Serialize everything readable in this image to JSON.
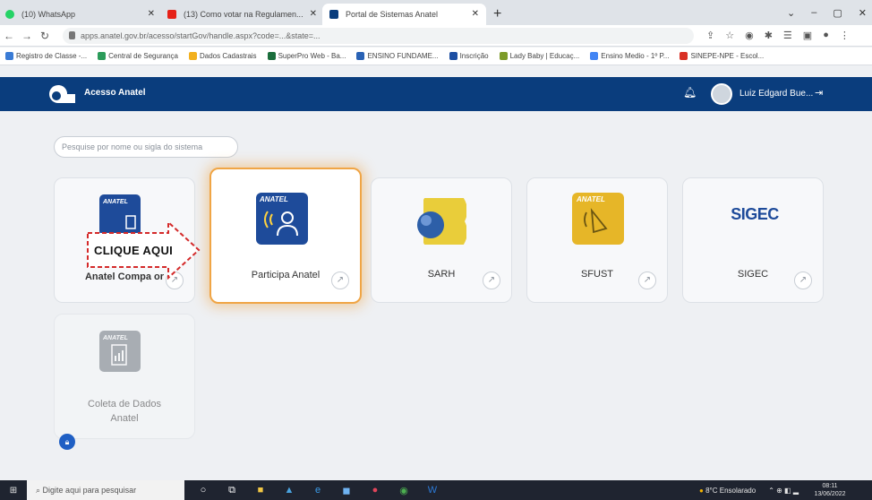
{
  "browser": {
    "tabs": [
      {
        "title": "(10) WhatsApp",
        "icon": "whatsapp-icon",
        "color": "#25d366",
        "active": false
      },
      {
        "title": "(13) Como votar na Regulamen...",
        "icon": "youtube-icon",
        "color": "#e62117",
        "active": false
      },
      {
        "title": "Portal de Sistemas Anatel",
        "icon": "anatel-icon",
        "color": "#0a3d7d",
        "active": true
      }
    ],
    "new_tab": "+",
    "url": "apps.anatel.gov.br/acesso/startGov/handle.aspx?code=...&state=...",
    "bookmarks": [
      "Registro de Classe -...",
      "Central de Segurança",
      "Dados Cadastrais",
      "SuperPro Web - Ba...",
      "ENSINO FUNDAME...",
      "Inscrição",
      "Lady Baby | Educaç...",
      "Ensino Medio - 1º P...",
      "SINEPE-NPE - Escol..."
    ]
  },
  "app": {
    "title": "Acesso Anatel",
    "user_name": "Luiz Edgard Bue...",
    "search_placeholder": "Pesquise por nome ou sigla do sistema",
    "brand_color": "#0a3d7d",
    "highlight_color": "#f0a545"
  },
  "cards": [
    {
      "id": "anatel-comparador",
      "label": "Anatel Comparador",
      "label_visible": "Anatel Compa      or"
    },
    {
      "id": "participa-anatel",
      "label": "Participa Anatel",
      "icon_caption": "ANATEL"
    },
    {
      "id": "sarh",
      "label": "SARH"
    },
    {
      "id": "sfust",
      "label": "SFUST",
      "icon_caption": "ANATEL"
    },
    {
      "id": "sigec",
      "label": "SIGEC",
      "icon_caption": "SIGEC"
    },
    {
      "id": "coleta-dados",
      "label_line1": "Coleta de Dados",
      "label_line2": "Anatel",
      "icon_caption": "ANATEL"
    }
  ],
  "callout": {
    "text": "CLIQUE AQUI"
  },
  "taskbar": {
    "search_placeholder": "Digite aqui para pesquisar",
    "weather": "8°C Ensolarado",
    "time": "08:11",
    "date": "13/06/2022"
  }
}
